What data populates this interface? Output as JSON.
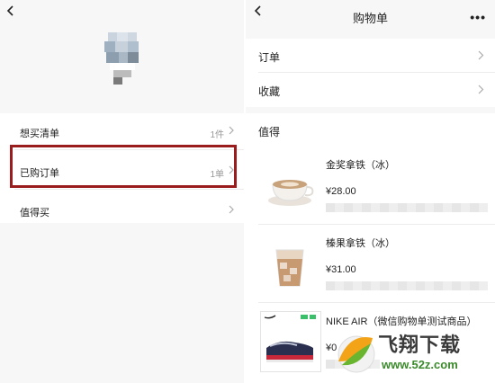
{
  "left": {
    "list": [
      {
        "label": "想买清单",
        "count": "1件"
      },
      {
        "label": "已购订单",
        "count": "1单"
      },
      {
        "label": "值得买",
        "count": ""
      }
    ]
  },
  "right": {
    "title": "购物单",
    "more": "•••",
    "menu": [
      {
        "label": "订单"
      },
      {
        "label": "收藏"
      }
    ],
    "section_title": "值得",
    "products": [
      {
        "name": "金奖拿铁（冰）",
        "price": "¥28.00"
      },
      {
        "name": "榛果拿铁（冰）",
        "price": "¥31.00"
      },
      {
        "name": "NIKE AIR（微信购物单测试商品）",
        "price": "¥0"
      }
    ]
  },
  "watermark": {
    "text": "飞翔下载",
    "url": "www.52z.com"
  },
  "colors": {
    "highlight": "#9b1c1c",
    "background": "#f7f7f7"
  }
}
